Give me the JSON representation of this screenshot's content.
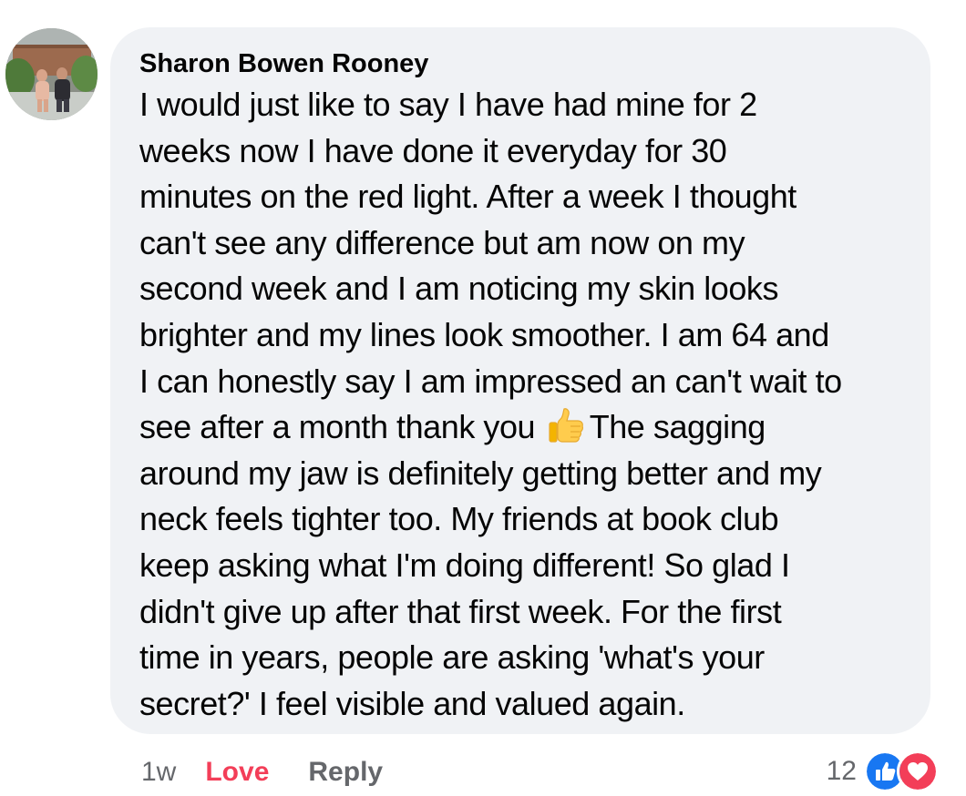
{
  "comment": {
    "author": "Sharon Bowen Rooney",
    "lines": [
      "I would just like to say I have had mine for 2",
      "weeks now I have done it everyday for 30",
      "minutes on the red light. After a week I thought",
      "can't see any difference but am now on my",
      "second week and I am noticing my skin looks",
      "brighter and my lines look smoother. I am 64 and",
      "I can honestly say I am impressed an can't wait to",
      "see after a month thank you",
      "around my jaw is definitely getting better and my",
      "neck feels tighter too. My friends at book club",
      "keep asking what I'm doing different! So glad I",
      "didn't give up after that first week. For the first",
      "time in years, people are asking 'what's your",
      "secret?' I feel visible and valued again."
    ],
    "line8_after_emoji": "The sagging",
    "inline_emoji": "thumbs-up-emoji"
  },
  "actions": {
    "time": "1w",
    "love_label": "Love",
    "reply_label": "Reply"
  },
  "reactions": {
    "count": "12",
    "icons": [
      "like-reaction-icon",
      "love-reaction-icon"
    ]
  },
  "colors": {
    "bubble_bg": "#f0f2f5",
    "text": "#050505",
    "secondary": "#65676b",
    "love": "#f33e58",
    "like": "#1877f2"
  }
}
